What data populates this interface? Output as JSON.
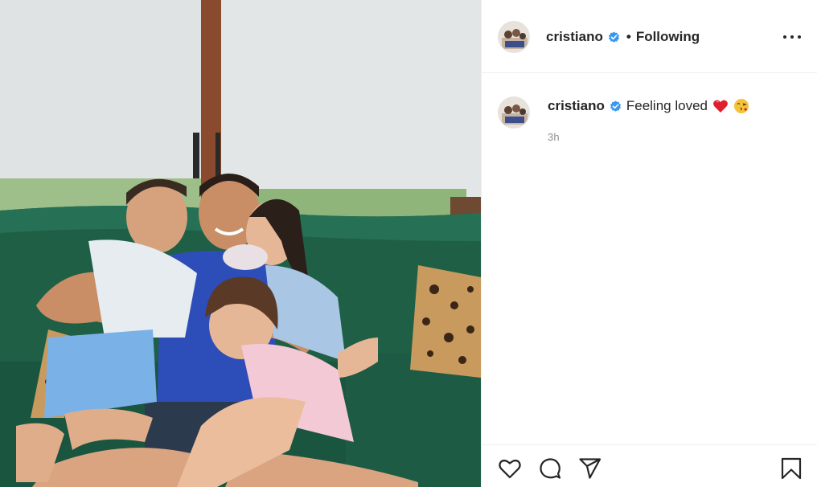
{
  "post": {
    "author": {
      "username": "cristiano",
      "verified": true,
      "avatar_icon": "profile-avatar-icon"
    },
    "header": {
      "separator": "•",
      "follow_state": "Following",
      "more_icon": "more-options-icon"
    },
    "caption": {
      "username": "cristiano",
      "text": "Feeling loved",
      "emojis": [
        "red-heart-emoji",
        "face-blowing-kiss-emoji"
      ]
    },
    "timestamp": "3h",
    "actions": [
      {
        "name": "like",
        "icon": "heart-icon"
      },
      {
        "name": "comment",
        "icon": "comment-bubble-icon"
      },
      {
        "name": "share",
        "icon": "paper-plane-icon"
      },
      {
        "name": "save",
        "icon": "bookmark-icon"
      }
    ],
    "colors": {
      "verified_blue": "#3897f0",
      "text": "#262626",
      "muted": "#8e8e8e",
      "sofa_green": "#1f5f45"
    }
  }
}
